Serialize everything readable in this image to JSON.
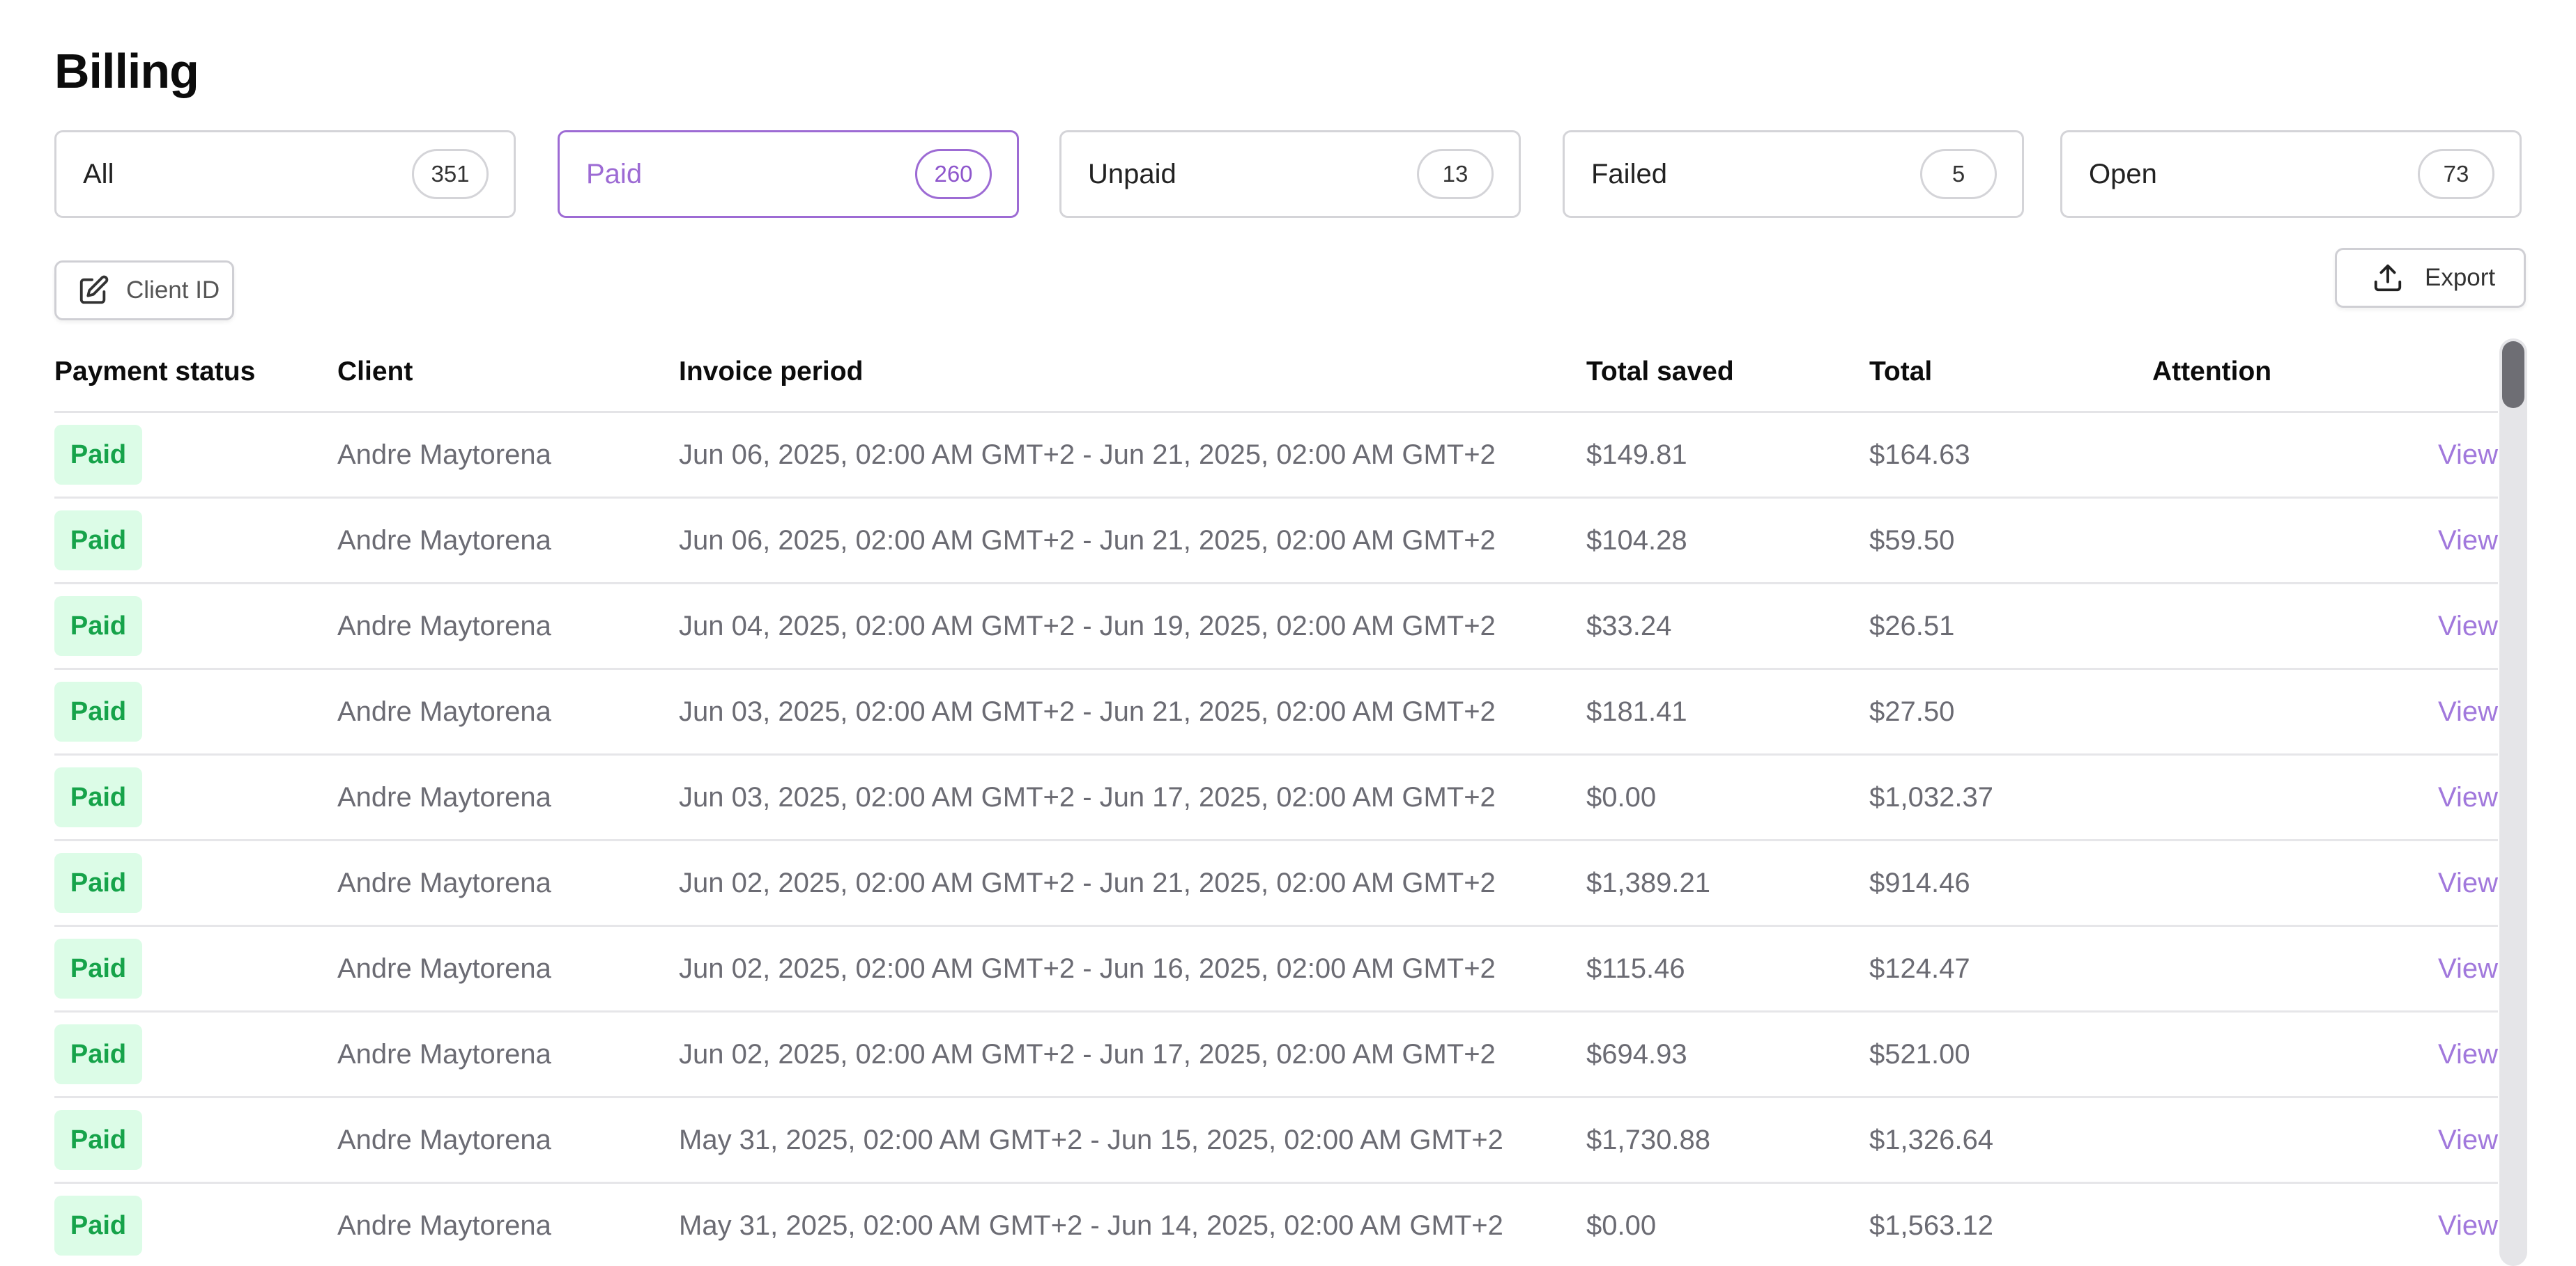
{
  "page": {
    "title": "Billing"
  },
  "tabs": [
    {
      "label": "All",
      "count": "351",
      "active": false
    },
    {
      "label": "Paid",
      "count": "260",
      "active": true
    },
    {
      "label": "Unpaid",
      "count": "13",
      "active": false
    },
    {
      "label": "Failed",
      "count": "5",
      "active": false
    },
    {
      "label": "Open",
      "count": "73",
      "active": false
    }
  ],
  "toolbar": {
    "client_id_label": "Client ID",
    "client_id_icon": "edit-icon",
    "export_label": "Export",
    "export_icon": "upload-icon"
  },
  "table": {
    "headers": [
      "Payment status",
      "Client",
      "Invoice period",
      "Total saved",
      "Total",
      "Attention"
    ],
    "view_label": "View",
    "rows": [
      {
        "status": "Paid",
        "client": "Andre Maytorena",
        "period": "Jun 06, 2025, 02:00 AM GMT+2 - Jun 21, 2025, 02:00 AM GMT+2",
        "total_saved": "$149.81",
        "total": "$164.63",
        "attention": ""
      },
      {
        "status": "Paid",
        "client": "Andre Maytorena",
        "period": "Jun 06, 2025, 02:00 AM GMT+2 - Jun 21, 2025, 02:00 AM GMT+2",
        "total_saved": "$104.28",
        "total": "$59.50",
        "attention": ""
      },
      {
        "status": "Paid",
        "client": "Andre Maytorena",
        "period": "Jun 04, 2025, 02:00 AM GMT+2 - Jun 19, 2025, 02:00 AM GMT+2",
        "total_saved": "$33.24",
        "total": "$26.51",
        "attention": ""
      },
      {
        "status": "Paid",
        "client": "Andre Maytorena",
        "period": "Jun 03, 2025, 02:00 AM GMT+2 - Jun 21, 2025, 02:00 AM GMT+2",
        "total_saved": "$181.41",
        "total": "$27.50",
        "attention": ""
      },
      {
        "status": "Paid",
        "client": "Andre Maytorena",
        "period": "Jun 03, 2025, 02:00 AM GMT+2 - Jun 17, 2025, 02:00 AM GMT+2",
        "total_saved": "$0.00",
        "total": "$1,032.37",
        "attention": ""
      },
      {
        "status": "Paid",
        "client": "Andre Maytorena",
        "period": "Jun 02, 2025, 02:00 AM GMT+2 - Jun 21, 2025, 02:00 AM GMT+2",
        "total_saved": "$1,389.21",
        "total": "$914.46",
        "attention": ""
      },
      {
        "status": "Paid",
        "client": "Andre Maytorena",
        "period": "Jun 02, 2025, 02:00 AM GMT+2 - Jun 16, 2025, 02:00 AM GMT+2",
        "total_saved": "$115.46",
        "total": "$124.47",
        "attention": ""
      },
      {
        "status": "Paid",
        "client": "Andre Maytorena",
        "period": "Jun 02, 2025, 02:00 AM GMT+2 - Jun 17, 2025, 02:00 AM GMT+2",
        "total_saved": "$694.93",
        "total": "$521.00",
        "attention": ""
      },
      {
        "status": "Paid",
        "client": "Andre Maytorena",
        "period": "May 31, 2025, 02:00 AM GMT+2 - Jun 15, 2025, 02:00 AM GMT+2",
        "total_saved": "$1,730.88",
        "total": "$1,326.64",
        "attention": ""
      },
      {
        "status": "Paid",
        "client": "Andre Maytorena",
        "period": "May 31, 2025, 02:00 AM GMT+2 - Jun 14, 2025, 02:00 AM GMT+2",
        "total_saved": "$0.00",
        "total": "$1,563.12",
        "attention": ""
      }
    ]
  },
  "colors": {
    "accent": "#9d6bd4",
    "paid_badge_bg": "#dcfce7",
    "paid_badge_text": "#16a34a",
    "view_link": "#a178dc"
  }
}
